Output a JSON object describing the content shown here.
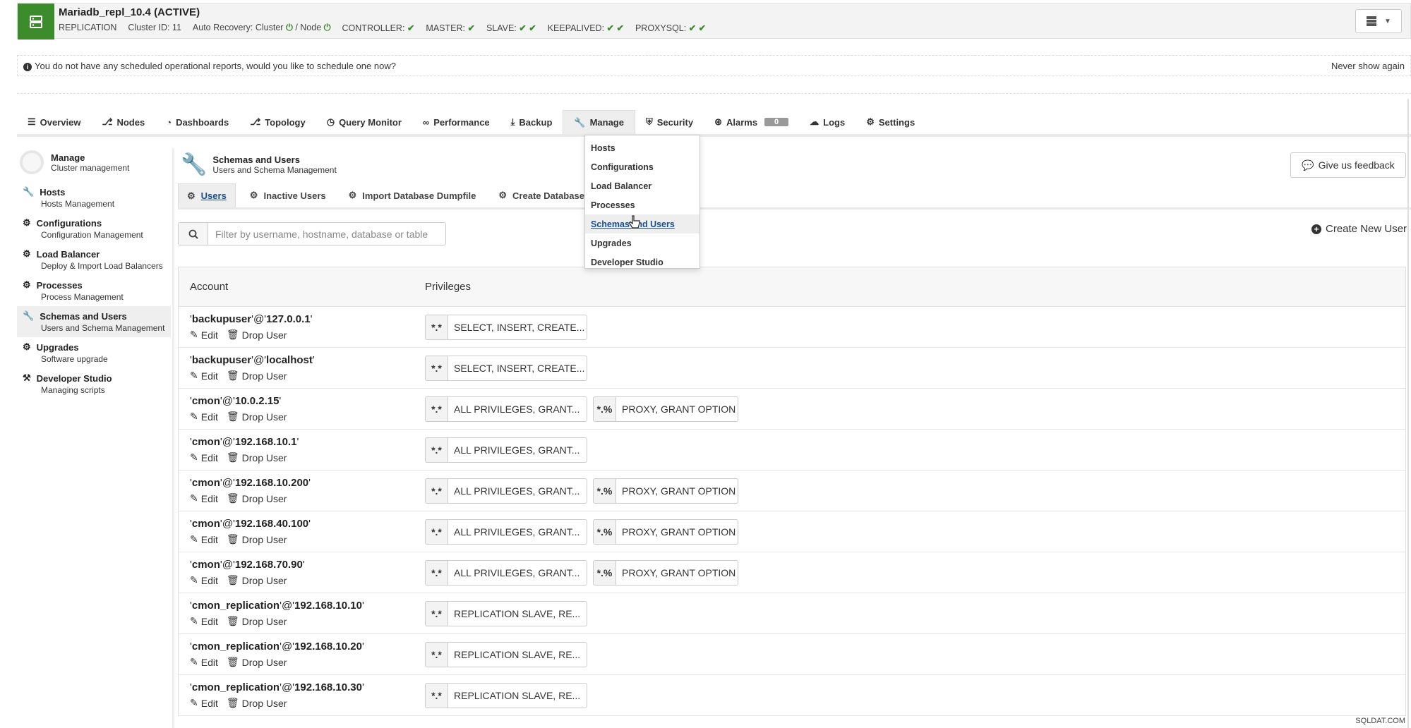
{
  "cluster": {
    "title": "Mariadb_repl_10.4 (ACTIVE)",
    "type": "REPLICATION",
    "cluster_id": "Cluster ID: 11",
    "auto_recovery_label": "Auto Recovery: Cluster",
    "auto_recovery_node": "/ Node",
    "roles": [
      {
        "label": "CONTROLLER:",
        "checks": "✔"
      },
      {
        "label": "MASTER:",
        "checks": "✔"
      },
      {
        "label": "SLAVE:",
        "checks": "✔ ✔"
      },
      {
        "label": "KEEPALIVED:",
        "checks": "✔ ✔"
      },
      {
        "label": "PROXYSQL:",
        "checks": "✔ ✔"
      }
    ]
  },
  "notice": {
    "text": "You do not have any scheduled operational reports, would you like to schedule one now?",
    "dismiss": "Never show again"
  },
  "tabs": [
    {
      "label": "Overview",
      "icon": "list-icon"
    },
    {
      "label": "Nodes",
      "icon": "nodes-icon"
    },
    {
      "label": "Dashboards",
      "icon": "dashboard-icon"
    },
    {
      "label": "Topology",
      "icon": "topology-icon"
    },
    {
      "label": "Query Monitor",
      "icon": "clock-icon"
    },
    {
      "label": "Performance",
      "icon": "chart-icon"
    },
    {
      "label": "Backup",
      "icon": "download-icon"
    },
    {
      "label": "Manage",
      "icon": "wrench-icon"
    },
    {
      "label": "Security",
      "icon": "shield-icon"
    },
    {
      "label": "Alarms",
      "icon": "broadcast-icon",
      "badge": "0"
    },
    {
      "label": "Logs",
      "icon": "logs-icon"
    },
    {
      "label": "Settings",
      "icon": "gear-icon"
    }
  ],
  "manage_menu": [
    "Hosts",
    "Configurations",
    "Load Balancer",
    "Processes",
    "Schemas and Users",
    "Upgrades",
    "Developer Studio"
  ],
  "sidebar": {
    "title": "Manage",
    "subtitle": "Cluster management",
    "items": [
      {
        "title": "Hosts",
        "subtitle": "Hosts Management",
        "icon": "wrench-icon"
      },
      {
        "title": "Configurations",
        "subtitle": "Configuration Management",
        "icon": "gear-icon"
      },
      {
        "title": "Load Balancer",
        "subtitle": "Deploy & Import Load Balancers",
        "icon": "gear-icon"
      },
      {
        "title": "Processes",
        "subtitle": "Process Management",
        "icon": "gear-icon"
      },
      {
        "title": "Schemas and Users",
        "subtitle": "Users and Schema Management",
        "icon": "wrench-icon"
      },
      {
        "title": "Upgrades",
        "subtitle": "Software upgrade",
        "icon": "gear-icon"
      },
      {
        "title": "Developer Studio",
        "subtitle": "Managing scripts",
        "icon": "hammer-icon"
      }
    ]
  },
  "main": {
    "title": "Schemas and Users",
    "subtitle": "Users and Schema Management",
    "feedback": "Give us feedback",
    "subtabs": [
      "Users",
      "Inactive Users",
      "Import Database Dumpfile",
      "Create Database"
    ],
    "filter_placeholder": "Filter by username, hostname, database or table",
    "create_user": "Create New User"
  },
  "table": {
    "headers": [
      "Account",
      "Privileges"
    ],
    "edit_label": "Edit",
    "drop_label": "Drop User",
    "rows": [
      {
        "user": "backupuser",
        "host": "127.0.0.1",
        "privs": [
          {
            "scope": "*.*",
            "grant": "SELECT, INSERT, CREATE..."
          }
        ]
      },
      {
        "user": "backupuser",
        "host": "localhost",
        "privs": [
          {
            "scope": "*.*",
            "grant": "SELECT, INSERT, CREATE..."
          }
        ]
      },
      {
        "user": "cmon",
        "host": "10.0.2.15",
        "privs": [
          {
            "scope": "*.*",
            "grant": "ALL PRIVILEGES, GRANT..."
          },
          {
            "scope": "*.%",
            "grant": "PROXY, GRANT OPTION"
          }
        ]
      },
      {
        "user": "cmon",
        "host": "192.168.10.1",
        "privs": [
          {
            "scope": "*.*",
            "grant": "ALL PRIVILEGES, GRANT..."
          }
        ]
      },
      {
        "user": "cmon",
        "host": "192.168.10.200",
        "privs": [
          {
            "scope": "*.*",
            "grant": "ALL PRIVILEGES, GRANT..."
          },
          {
            "scope": "*.%",
            "grant": "PROXY, GRANT OPTION"
          }
        ]
      },
      {
        "user": "cmon",
        "host": "192.168.40.100",
        "privs": [
          {
            "scope": "*.*",
            "grant": "ALL PRIVILEGES, GRANT..."
          },
          {
            "scope": "*.%",
            "grant": "PROXY, GRANT OPTION"
          }
        ]
      },
      {
        "user": "cmon",
        "host": "192.168.70.90",
        "privs": [
          {
            "scope": "*.*",
            "grant": "ALL PRIVILEGES, GRANT..."
          },
          {
            "scope": "*.%",
            "grant": "PROXY, GRANT OPTION"
          }
        ]
      },
      {
        "user": "cmon_replication",
        "host": "192.168.10.10",
        "privs": [
          {
            "scope": "*.*",
            "grant": "REPLICATION SLAVE, RE..."
          }
        ]
      },
      {
        "user": "cmon_replication",
        "host": "192.168.10.20",
        "privs": [
          {
            "scope": "*.*",
            "grant": "REPLICATION SLAVE, RE..."
          }
        ]
      },
      {
        "user": "cmon_replication",
        "host": "192.168.10.30",
        "privs": [
          {
            "scope": "*.*",
            "grant": "REPLICATION SLAVE, RE..."
          }
        ]
      }
    ]
  },
  "watermark": "SQLDAT.COM",
  "colors": {
    "brand_green": "#3c8b2d",
    "link_blue": "#1a4e8f"
  }
}
